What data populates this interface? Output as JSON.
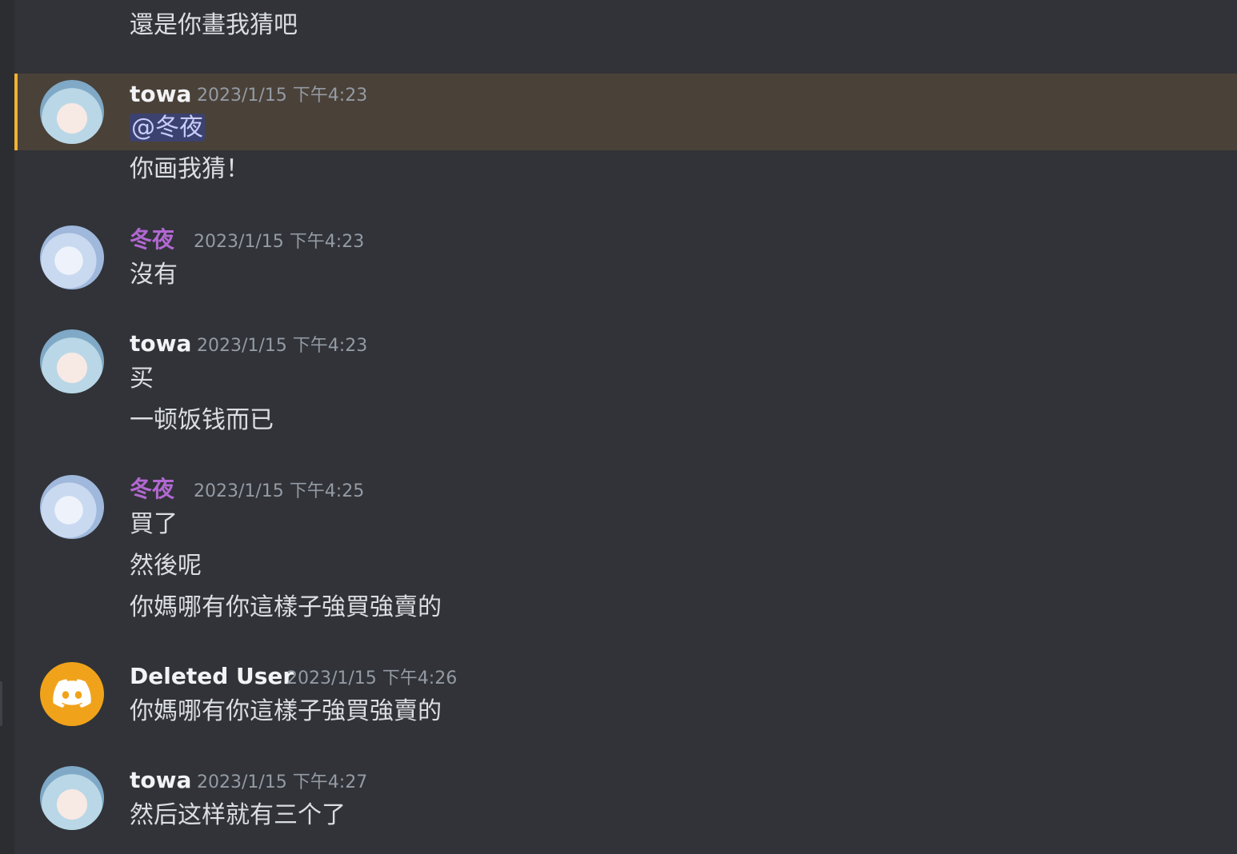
{
  "messages": [
    {
      "lines": [
        "還是你畫我猜吧"
      ]
    },
    {
      "author": "towa",
      "time": "2023/1/15 下午4:23",
      "mention": "@冬夜",
      "lines": [
        "你画我猜！"
      ]
    },
    {
      "author": "冬夜",
      "time": "2023/1/15 下午4:23",
      "lines": [
        "沒有"
      ]
    },
    {
      "author": "towa",
      "time": "2023/1/15 下午4:23",
      "lines": [
        "买",
        "一顿饭钱而已"
      ]
    },
    {
      "author": "冬夜",
      "time": "2023/1/15 下午4:25",
      "lines": [
        "買了",
        "然後呢",
        "你媽哪有你這樣子強買強賣的"
      ]
    },
    {
      "author": "Deleted User",
      "time": "2023/1/15 下午4:26",
      "lines": [
        "你媽哪有你這樣子強買強賣的"
      ]
    },
    {
      "author": "towa",
      "time": "2023/1/15 下午4:27",
      "lines": [
        "然后这样就有三个了"
      ]
    }
  ],
  "colors": {
    "background": "#313338",
    "mention_highlight": "#4a4139",
    "highlight_bar": "#f0b232",
    "fuyu_name": "#b268d2",
    "deleted_avatar": "#f0a31a"
  },
  "icons": {
    "deleted_avatar": "discord-logo-icon"
  }
}
